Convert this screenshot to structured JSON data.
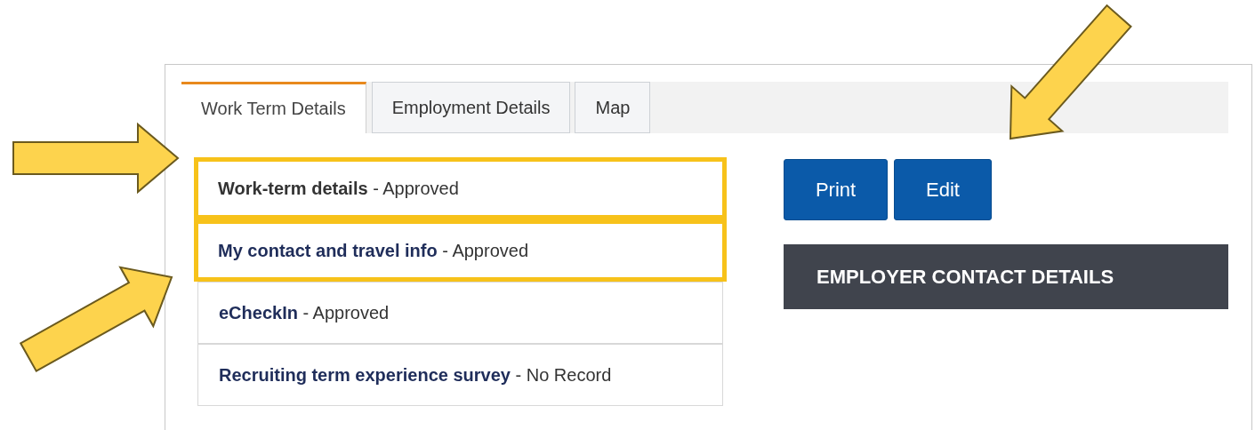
{
  "tabs": [
    {
      "label": "Work Term Details",
      "selected": true
    },
    {
      "label": "Employment Details",
      "selected": false
    },
    {
      "label": "Map",
      "selected": false
    }
  ],
  "sections": [
    {
      "title": "Work-term details",
      "status": " - Approved",
      "color": "#333333",
      "highlighted": true
    },
    {
      "title": "My contact and travel info",
      "status": " - Approved",
      "color": "#1f2d5a",
      "highlighted": true
    },
    {
      "title": "eCheckIn",
      "status": " - Approved",
      "color": "#1f2d5a",
      "highlighted": false
    },
    {
      "title": "Recruiting term experience survey",
      "status": " - No Record",
      "color": "#1f2d5a",
      "highlighted": false
    }
  ],
  "buttons": [
    "Print",
    "Edit"
  ],
  "panel_header": "EMPLOYER CONTACT DETAILS",
  "annotations": [
    {
      "kind": "arrow"
    },
    {
      "kind": "arrow"
    },
    {
      "kind": "arrow"
    }
  ]
}
